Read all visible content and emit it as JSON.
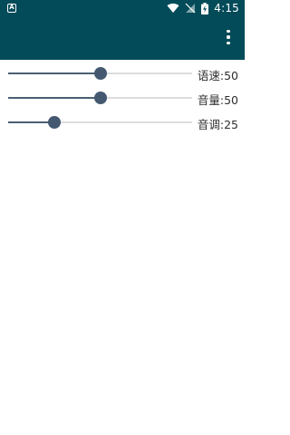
{
  "status_bar": {
    "notification_icon_label": "A",
    "time": "4:15",
    "icons": [
      "wifi-icon",
      "no-sim-icon",
      "battery-charging-icon"
    ]
  },
  "app_bar": {
    "background_color": "#034b59",
    "menu_icon": "overflow-menu-icon"
  },
  "sliders": [
    {
      "label": "语速:50",
      "value": 50,
      "max": 100
    },
    {
      "label": "音量:50",
      "value": 50,
      "max": 100
    },
    {
      "label": "音调:25",
      "value": 25,
      "max": 100
    }
  ],
  "colors": {
    "accent": "#445970",
    "track": "#dadcde"
  }
}
